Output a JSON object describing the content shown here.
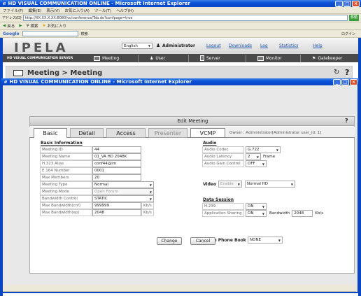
{
  "window": {
    "title": "HD VISUAL COMMUNICATION ONLINE - Microsoft Internet Explorer"
  },
  "menu": [
    "ファイル(F)",
    "編集(E)",
    "表示(V)",
    "お気に入り(A)",
    "ツール(T)",
    "ヘルプ(H)"
  ],
  "address": {
    "label": "アドレス(D)",
    "url": "http://XX.XX.X.XX:8080/vc/conference/Tab.do?confpage=true",
    "go": "移動"
  },
  "toolbar": {
    "back": "戻る",
    "search": "検索",
    "favorites": "お気に入り"
  },
  "google": {
    "label": "Google",
    "search_label": "検索",
    "login": "ログイン"
  },
  "ipela": {
    "logo": "IPELA",
    "language": "English",
    "user": "Administrator",
    "logout": "Logout",
    "downloads": "Downloads",
    "log": "Log",
    "statistics": "Statistics",
    "help": "Help"
  },
  "navbar": {
    "server": "HD VISUAL COMMUNICATION SERVER",
    "items": [
      "Meeting",
      "User",
      "Server",
      "Monitor",
      "Gatekeeper"
    ]
  },
  "breadcrumb": "Meeting > Meeting",
  "popup": {
    "title": "HD VISUAL COMMUNICATION ONLINE - Microsoft Internet Explorer",
    "heading": "Edit Meeting",
    "help": "?"
  },
  "tabs": [
    "Basic",
    "Detail",
    "Access",
    "Presenter",
    "VCMP"
  ],
  "owner": "Owner : Administrator[Administrator user_id: 1]",
  "basic": {
    "title": "Basic Information",
    "rows": [
      {
        "label": "Meeting ID",
        "value": "44"
      },
      {
        "label": "Meeting Name",
        "value": "01_VA HD 2048K"
      },
      {
        "label": "H.323 Alias",
        "value": "conf44@im"
      },
      {
        "label": "E.164 Number",
        "value": "0001"
      },
      {
        "label": "Max Members",
        "value": "20"
      },
      {
        "label": "Meeting Type",
        "value": "Normal"
      },
      {
        "label": "Meeting Mode",
        "value": "Open Forum"
      },
      {
        "label": "Bandwidth Control",
        "value": "STATIC"
      },
      {
        "label": "Max Bandwidth(cnf)",
        "value": "999999",
        "unit": "Kb/s"
      },
      {
        "label": "Max Bandwidth(ep)",
        "value": "2048",
        "unit": "Kb/s"
      }
    ]
  },
  "audio": {
    "title": "Audio",
    "codec_label": "Audio Codec",
    "codec": "G.722",
    "latency_label": "Audio Latency",
    "latency": "2",
    "latency_unit": "Frame",
    "gain_label": "Audio Gain Control",
    "gain": "OFF"
  },
  "video": {
    "label": "Video",
    "enable": "Enable",
    "mode": "Normal HD"
  },
  "data": {
    "title": "Data Session",
    "h239_label": "H.239",
    "h239": "ON",
    "share_label": "Application Sharing",
    "share": "ON",
    "bw_label": "Bandwidth",
    "bw": "2048",
    "bw_unit": "Kb/s"
  },
  "phonebook": {
    "label": "Share Phone Book",
    "value": "NONE"
  },
  "buttons": {
    "change": "Change",
    "cancel": "Cancel"
  }
}
